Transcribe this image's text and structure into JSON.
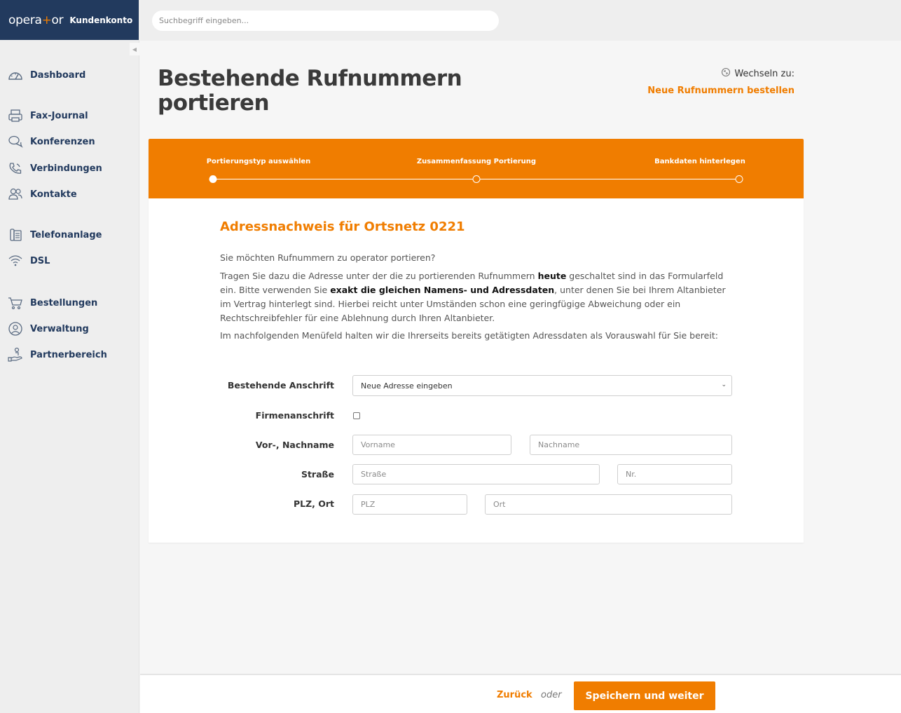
{
  "brand": {
    "logo": "opera+or",
    "logo_pre": "opera",
    "logo_plus": "+",
    "logo_post": "or",
    "account": "Kundenkonto"
  },
  "search": {
    "placeholder": "Suchbegriff eingeben..."
  },
  "sidebar": {
    "items": [
      {
        "label": "Dashboard",
        "icon": "gauge-icon"
      },
      {
        "label": "Fax-Journal",
        "icon": "printer-icon"
      },
      {
        "label": "Konferenzen",
        "icon": "chat-icon"
      },
      {
        "label": "Verbindungen",
        "icon": "phone-icon"
      },
      {
        "label": "Kontakte",
        "icon": "contacts-icon"
      },
      {
        "label": "Telefonanlage",
        "icon": "pbx-icon"
      },
      {
        "label": "DSL",
        "icon": "wifi-icon"
      },
      {
        "label": "Bestellungen",
        "icon": "cart-icon"
      },
      {
        "label": "Verwaltung",
        "icon": "user-circle-icon"
      },
      {
        "label": "Partnerbereich",
        "icon": "partner-icon"
      }
    ]
  },
  "header": {
    "title": "Bestehende Rufnummern portieren",
    "switch_label": "Wechseln zu:",
    "switch_link": "Neue Rufnummern bestellen"
  },
  "stepper": {
    "steps": [
      {
        "label": "Portierungstyp auswählen",
        "active": true
      },
      {
        "label": "Zusammenfassung Portierung",
        "active": false
      },
      {
        "label": "Bankdaten hinterlegen",
        "active": false
      }
    ]
  },
  "content": {
    "section_title": "Adressnachweis für Ortsnetz 0221",
    "intro": "Sie möchten Rufnummern zu operator portieren?",
    "p1_a": "Tragen Sie dazu die Adresse unter der die zu portierenden Rufnummern ",
    "p1_b": "heute",
    "p1_c": " geschaltet sind in das Formularfeld ein. Bitte verwenden Sie ",
    "p1_d": "exakt die gleichen Namens- und Adressdaten",
    "p1_e": ", unter denen Sie bei Ihrem Altanbieter im Vertrag hinterlegt sind. Hierbei reicht unter Umständen schon eine geringfügige Abweichung oder ein Rechtschreibfehler für eine Ablehnung durch Ihren Altanbieter.",
    "p2": "Im nachfolgenden Menüfeld halten wir die Ihrerseits bereits getätigten Adressdaten als Vorauswahl für Sie bereit:"
  },
  "form": {
    "address_label": "Bestehende Anschrift",
    "address_value": "Neue Adresse eingeben",
    "company_label": "Firmenanschrift",
    "name_label": "Vor-, Nachname",
    "firstname_placeholder": "Vorname",
    "lastname_placeholder": "Nachname",
    "street_label": "Straße",
    "street_placeholder": "Straße",
    "number_placeholder": "Nr.",
    "zip_label": "PLZ, Ort",
    "zip_placeholder": "PLZ",
    "city_placeholder": "Ort"
  },
  "footer": {
    "back": "Zurück",
    "or": "oder",
    "save": "Speichern und weiter"
  },
  "colors": {
    "accent": "#f07d00",
    "brand": "#223a5e",
    "nav_text": "#223a5e"
  }
}
